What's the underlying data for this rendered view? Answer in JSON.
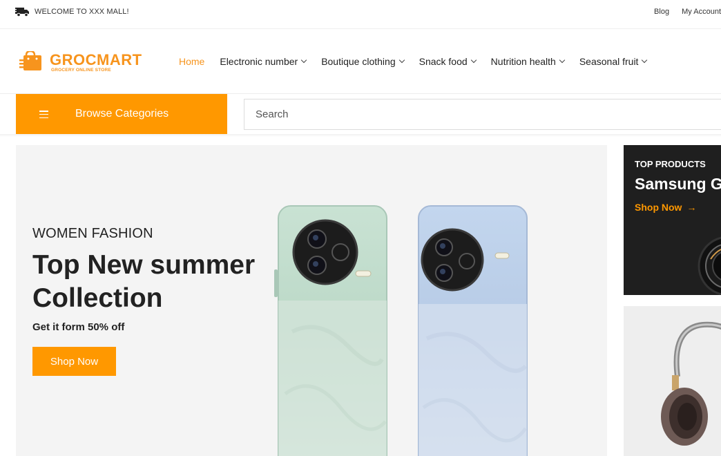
{
  "topbar": {
    "welcome": "WELCOME TO XXX MALL!",
    "links": [
      "Blog",
      "My Account"
    ],
    "truck_icon": "truck-icon"
  },
  "header": {
    "logo_name": "GROCMART",
    "logo_tagline": "GROCERY ONLINE STORE",
    "nav": [
      {
        "label": "Home",
        "active": true,
        "dropdown": false
      },
      {
        "label": "Electronic number",
        "dropdown": true
      },
      {
        "label": "Boutique clothing",
        "dropdown": true
      },
      {
        "label": "Snack food",
        "dropdown": true
      },
      {
        "label": "Nutrition health",
        "dropdown": true
      },
      {
        "label": "Seasonal fruit",
        "dropdown": true
      }
    ]
  },
  "browse": {
    "label": "Browse Categories",
    "icon": "hamburger-icon"
  },
  "search": {
    "placeholder": "Search"
  },
  "hero": {
    "subtitle": "WOMEN FASHION",
    "title": "Top New summer Collection",
    "offer": "Get it form 50% off",
    "cta": "Shop Now"
  },
  "promo_top": {
    "subtitle": "TOP PRODUCTS",
    "title": "Samsung Galaxy",
    "cta": "Shop Now",
    "arrow": "→"
  },
  "colors": {
    "accent": "#ff9800",
    "brand": "#f7941d",
    "dark": "#1f1f1f",
    "hero_bg": "#f4f4f4"
  }
}
